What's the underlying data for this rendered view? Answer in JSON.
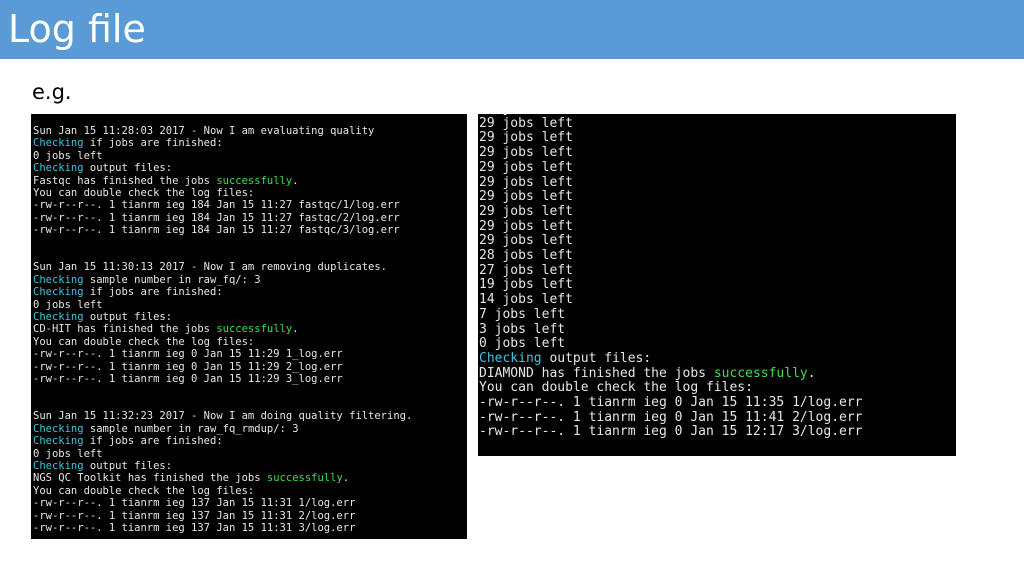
{
  "slide": {
    "title": "Log file",
    "example_label": "e.g."
  },
  "colors": {
    "title_bar": "#5b9bd5",
    "terminal_bg": "#000000",
    "terminal_text": "#e6e6e6",
    "keyword_checking": "#3dc5e0",
    "keyword_successfully": "#38e04c"
  },
  "terminal_left": {
    "lines": [
      {
        "text": "Sun Jan 15 11:28:03 2017 - Now I am evaluating quality"
      },
      {
        "hl": "Checking",
        "rest": " if jobs are finished:"
      },
      {
        "text": "0 jobs left"
      },
      {
        "hl": "Checking",
        "rest": " output files:"
      },
      {
        "pre": "Fastqc has finished the jobs ",
        "ok": "successfully",
        "post": "."
      },
      {
        "text": "You can double check the log files:"
      },
      {
        "text": "-rw-r--r--. 1 tianrm ieg 184 Jan 15 11:27 fastqc/1/log.err"
      },
      {
        "text": "-rw-r--r--. 1 tianrm ieg 184 Jan 15 11:27 fastqc/2/log.err"
      },
      {
        "text": "-rw-r--r--. 1 tianrm ieg 184 Jan 15 11:27 fastqc/3/log.err"
      },
      {
        "text": ""
      },
      {
        "text": ""
      },
      {
        "text": "Sun Jan 15 11:30:13 2017 - Now I am removing duplicates."
      },
      {
        "hl": "Checking",
        "rest": " sample number in raw_fq/: 3"
      },
      {
        "hl": "Checking",
        "rest": " if jobs are finished:"
      },
      {
        "text": "0 jobs left"
      },
      {
        "hl": "Checking",
        "rest": " output files:"
      },
      {
        "pre": "CD-HIT has finished the jobs ",
        "ok": "successfully",
        "post": "."
      },
      {
        "text": "You can double check the log files:"
      },
      {
        "text": "-rw-r--r--. 1 tianrm ieg 0 Jan 15 11:29 1_log.err"
      },
      {
        "text": "-rw-r--r--. 1 tianrm ieg 0 Jan 15 11:29 2_log.err"
      },
      {
        "text": "-rw-r--r--. 1 tianrm ieg 0 Jan 15 11:29 3_log.err"
      },
      {
        "text": ""
      },
      {
        "text": ""
      },
      {
        "text": "Sun Jan 15 11:32:23 2017 - Now I am doing quality filtering."
      },
      {
        "hl": "Checking",
        "rest": " sample number in raw_fq_rmdup/: 3"
      },
      {
        "hl": "Checking",
        "rest": " if jobs are finished:"
      },
      {
        "text": "0 jobs left"
      },
      {
        "hl": "Checking",
        "rest": " output files:"
      },
      {
        "pre": "NGS QC Toolkit has finished the jobs ",
        "ok": "successfully",
        "post": "."
      },
      {
        "text": "You can double check the log files:"
      },
      {
        "text": "-rw-r--r--. 1 tianrm ieg 137 Jan 15 11:31 1/log.err"
      },
      {
        "text": "-rw-r--r--. 1 tianrm ieg 137 Jan 15 11:31 2/log.err"
      },
      {
        "text": "-rw-r--r--. 1 tianrm ieg 137 Jan 15 11:31 3/log.err"
      }
    ]
  },
  "terminal_right": {
    "lines": [
      {
        "text": "29 jobs left"
      },
      {
        "text": "29 jobs left"
      },
      {
        "text": "29 jobs left"
      },
      {
        "text": "29 jobs left"
      },
      {
        "text": "29 jobs left"
      },
      {
        "text": "29 jobs left"
      },
      {
        "text": "29 jobs left"
      },
      {
        "text": "29 jobs left"
      },
      {
        "text": "29 jobs left"
      },
      {
        "text": "29 jobs left"
      },
      {
        "text": "28 jobs left"
      },
      {
        "text": "27 jobs left"
      },
      {
        "text": "19 jobs left"
      },
      {
        "text": "14 jobs left"
      },
      {
        "text": "7 jobs left"
      },
      {
        "text": "3 jobs left"
      },
      {
        "text": "0 jobs left"
      },
      {
        "hl": "Checking",
        "rest": " output files:"
      },
      {
        "pre": "DIAMOND has finished the jobs ",
        "ok": "successfully",
        "post": "."
      },
      {
        "text": "You can double check the log files:"
      },
      {
        "text": "-rw-r--r--. 1 tianrm ieg 0 Jan 15 11:35 1/log.err"
      },
      {
        "text": "-rw-r--r--. 1 tianrm ieg 0 Jan 15 11:41 2/log.err"
      },
      {
        "text": "-rw-r--r--. 1 tianrm ieg 0 Jan 15 12:17 3/log.err"
      }
    ]
  }
}
